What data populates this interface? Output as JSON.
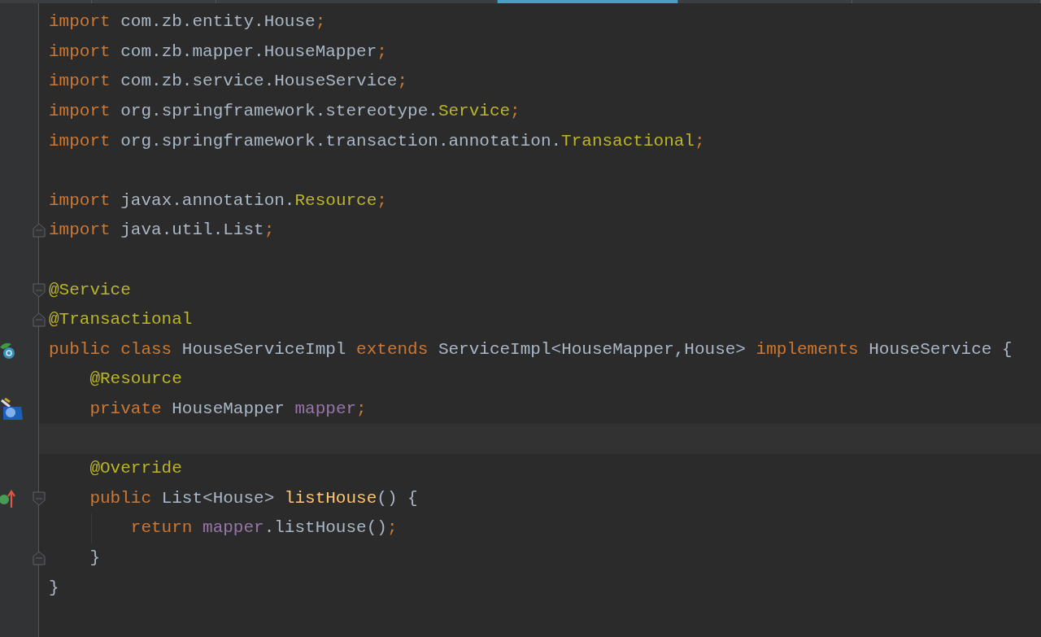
{
  "tabs": [
    {
      "selected": false
    },
    {
      "selected": false
    },
    {
      "selected": false
    },
    {
      "selected": true
    },
    {
      "selected": false
    },
    {
      "selected": false
    }
  ],
  "editor": {
    "lines": [
      {
        "tokens": [
          {
            "text": "import ",
            "kind": "keyword"
          },
          {
            "text": "com.zb.entity.House",
            "kind": "plain"
          },
          {
            "text": ";",
            "kind": "keyword"
          }
        ]
      },
      {
        "tokens": [
          {
            "text": "import ",
            "kind": "keyword"
          },
          {
            "text": "com.zb.mapper.HouseMapper",
            "kind": "plain"
          },
          {
            "text": ";",
            "kind": "keyword"
          }
        ]
      },
      {
        "tokens": [
          {
            "text": "import ",
            "kind": "keyword"
          },
          {
            "text": "com.zb.service.HouseService",
            "kind": "plain"
          },
          {
            "text": ";",
            "kind": "keyword"
          }
        ]
      },
      {
        "tokens": [
          {
            "text": "import ",
            "kind": "keyword"
          },
          {
            "text": "org.springframework.stereotype.",
            "kind": "plain"
          },
          {
            "text": "Service",
            "kind": "annotation"
          },
          {
            "text": ";",
            "kind": "keyword"
          }
        ]
      },
      {
        "tokens": [
          {
            "text": "import ",
            "kind": "keyword"
          },
          {
            "text": "org.springframework.transaction.annotation.",
            "kind": "plain"
          },
          {
            "text": "Transactional",
            "kind": "annotation"
          },
          {
            "text": ";",
            "kind": "keyword"
          }
        ]
      },
      {
        "tokens": [
          {
            "text": "import ",
            "kind": "keyword"
          },
          {
            "text": "javax.annotation.",
            "kind": "plain"
          },
          {
            "text": "Resource",
            "kind": "annotation"
          },
          {
            "text": ";",
            "kind": "keyword"
          }
        ],
        "blank_line_before": true
      },
      {
        "tokens": [
          {
            "text": "import ",
            "kind": "keyword"
          },
          {
            "text": "java.util.List",
            "kind": "plain"
          },
          {
            "text": ";",
            "kind": "keyword"
          }
        ],
        "fold_marker": {
          "kind": "end"
        }
      },
      {
        "tokens": [
          {
            "text": "@Service",
            "kind": "annotation"
          }
        ],
        "fold_marker": {
          "kind": "start"
        },
        "blank_line_before": true
      },
      {
        "tokens": [
          {
            "text": "@Transactional",
            "kind": "annotation"
          }
        ],
        "fold_marker": {
          "kind": "end"
        }
      },
      {
        "tokens": [
          {
            "text": "public class ",
            "kind": "keyword"
          },
          {
            "text": "HouseServiceImpl ",
            "kind": "plain"
          },
          {
            "text": "extends ",
            "kind": "keyword"
          },
          {
            "text": "ServiceImpl<HouseMapper,House> ",
            "kind": "plain"
          },
          {
            "text": "implements ",
            "kind": "keyword"
          },
          {
            "text": "HouseService {",
            "kind": "plain"
          }
        ],
        "gutter_icon": {
          "kind": "class"
        }
      },
      {
        "tokens": [
          {
            "text": "    @Resource",
            "kind": "annotation"
          }
        ]
      },
      {
        "tokens": [
          {
            "text": "    private ",
            "kind": "keyword"
          },
          {
            "text": "HouseMapper ",
            "kind": "plain"
          },
          {
            "text": "mapper",
            "kind": "field"
          },
          {
            "text": ";",
            "kind": "keyword"
          }
        ],
        "gutter_icon": {
          "kind": "bean"
        }
      },
      {
        "current": true
      },
      {
        "tokens": [
          {
            "text": "    @Override",
            "kind": "annotation"
          }
        ]
      },
      {
        "tokens": [
          {
            "text": "    public ",
            "kind": "keyword"
          },
          {
            "text": "List<House> ",
            "kind": "plain"
          },
          {
            "text": "listHouse",
            "kind": "method"
          },
          {
            "text": "() {",
            "kind": "plain"
          }
        ],
        "fold_marker": {
          "kind": "start"
        },
        "gutter_icon": {
          "kind": "implements"
        }
      },
      {
        "tokens": [
          {
            "text": "        return ",
            "kind": "keyword"
          },
          {
            "text": "mapper",
            "kind": "field"
          },
          {
            "text": ".listHouse()",
            "kind": "plain"
          },
          {
            "text": ";",
            "kind": "keyword"
          }
        ],
        "guide": true
      },
      {
        "tokens": [
          {
            "text": "    }",
            "kind": "plain"
          }
        ],
        "fold_marker": {
          "kind": "end"
        }
      },
      {
        "tokens": [
          {
            "text": "}",
            "kind": "plain"
          }
        ]
      }
    ]
  }
}
